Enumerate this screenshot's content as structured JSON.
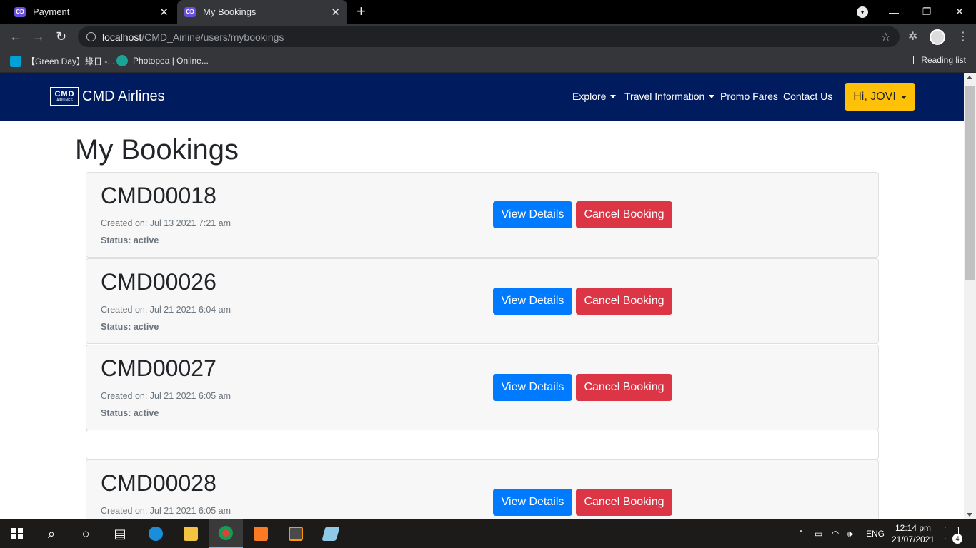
{
  "browser": {
    "tabs": [
      {
        "title": "Payment",
        "active": false
      },
      {
        "title": "My Bookings",
        "active": true
      }
    ],
    "new_tab_icon": "plus-icon",
    "url_host": "localhost",
    "url_path": "/CMD_Airline/users/mybookings",
    "bookmarks": [
      {
        "label": "【Green Day】綠日 -..."
      },
      {
        "label": "Photopea | Online..."
      }
    ],
    "reading_list_label": "Reading list"
  },
  "site": {
    "brand_name": "CMD Airlines",
    "logo_text": "CMD",
    "logo_subtext": "AIRLINES",
    "nav": {
      "explore": "Explore",
      "travel_info": "Travel Information",
      "promo_fares": "Promo Fares",
      "contact_us": "Contact Us",
      "user_greeting": "Hi, JOVI"
    },
    "colors": {
      "navbar": "#001b5e",
      "user_button": "#ffc107",
      "view_button": "#007bff",
      "cancel_button": "#dc3545"
    }
  },
  "page": {
    "title": "My Bookings",
    "bookings": [
      {
        "code": "CMD00018",
        "created": "Created on: Jul 13 2021 7:21 am",
        "status": "Status: active",
        "view_label": "View Details",
        "cancel_label": "Cancel Booking"
      },
      {
        "code": "CMD00026",
        "created": "Created on: Jul 21 2021 6:04 am",
        "status": "Status: active",
        "view_label": "View Details",
        "cancel_label": "Cancel Booking"
      },
      {
        "code": "CMD00027",
        "created": "Created on: Jul 21 2021 6:05 am",
        "status": "Status: active",
        "view_label": "View Details",
        "cancel_label": "Cancel Booking"
      },
      {
        "code": "CMD00028",
        "created": "Created on: Jul 21 2021 6:05 am",
        "status": "",
        "view_label": "View Details",
        "cancel_label": "Cancel Booking"
      }
    ]
  },
  "taskbar": {
    "language": "ENG",
    "time": "12:14 pm",
    "date": "21/07/2021",
    "notification_count": "4"
  }
}
